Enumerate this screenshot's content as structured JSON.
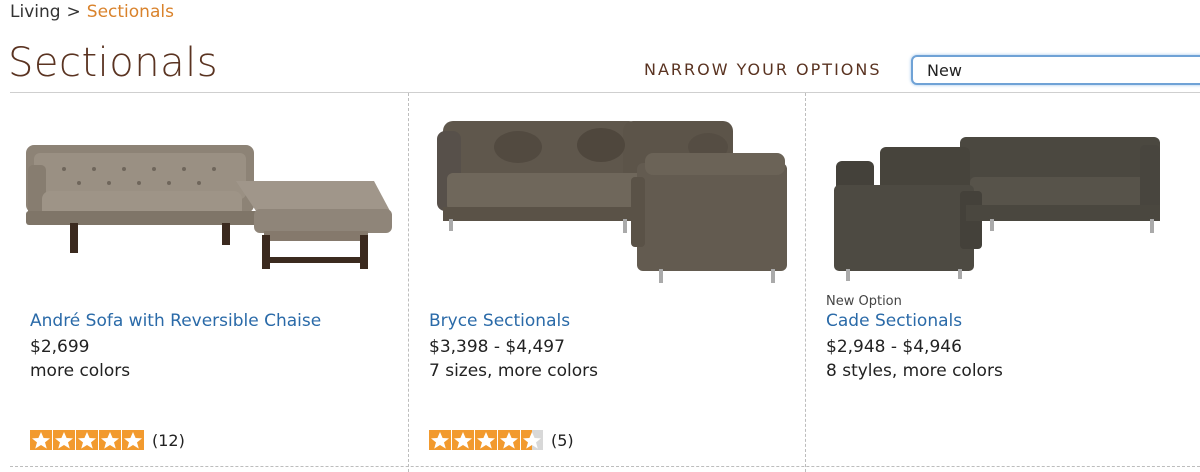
{
  "breadcrumb": {
    "parent": "Living",
    "separator": ">",
    "current": "Sectionals"
  },
  "page": {
    "title": "Sectionals"
  },
  "filter": {
    "label": "NARROW YOUR OPTIONS",
    "selected": "New"
  },
  "colors": {
    "brand_brown": "#5a3321",
    "link_blue": "#2a6aa8",
    "breadcrumb_orange": "#d9822b",
    "star_orange": "#f29a2e"
  },
  "products": [
    {
      "image": "sofa-with-chaise-image",
      "badge": "",
      "name": "André Sofa with Reversible Chaise",
      "price": "$2,699",
      "options": "more colors",
      "rating": 5,
      "reviews": "(12)"
    },
    {
      "image": "corner-sectional-image",
      "badge": "",
      "name": "Bryce Sectionals",
      "price": "$3,398 - $4,497",
      "options": "7 sizes, more colors",
      "rating": 4.5,
      "reviews": "(5)"
    },
    {
      "image": "corner-sectional-image",
      "badge": "New Option",
      "name": "Cade Sectionals",
      "price": "$2,948 - $4,946",
      "options": "8 styles, more colors",
      "rating": null,
      "reviews": ""
    }
  ]
}
